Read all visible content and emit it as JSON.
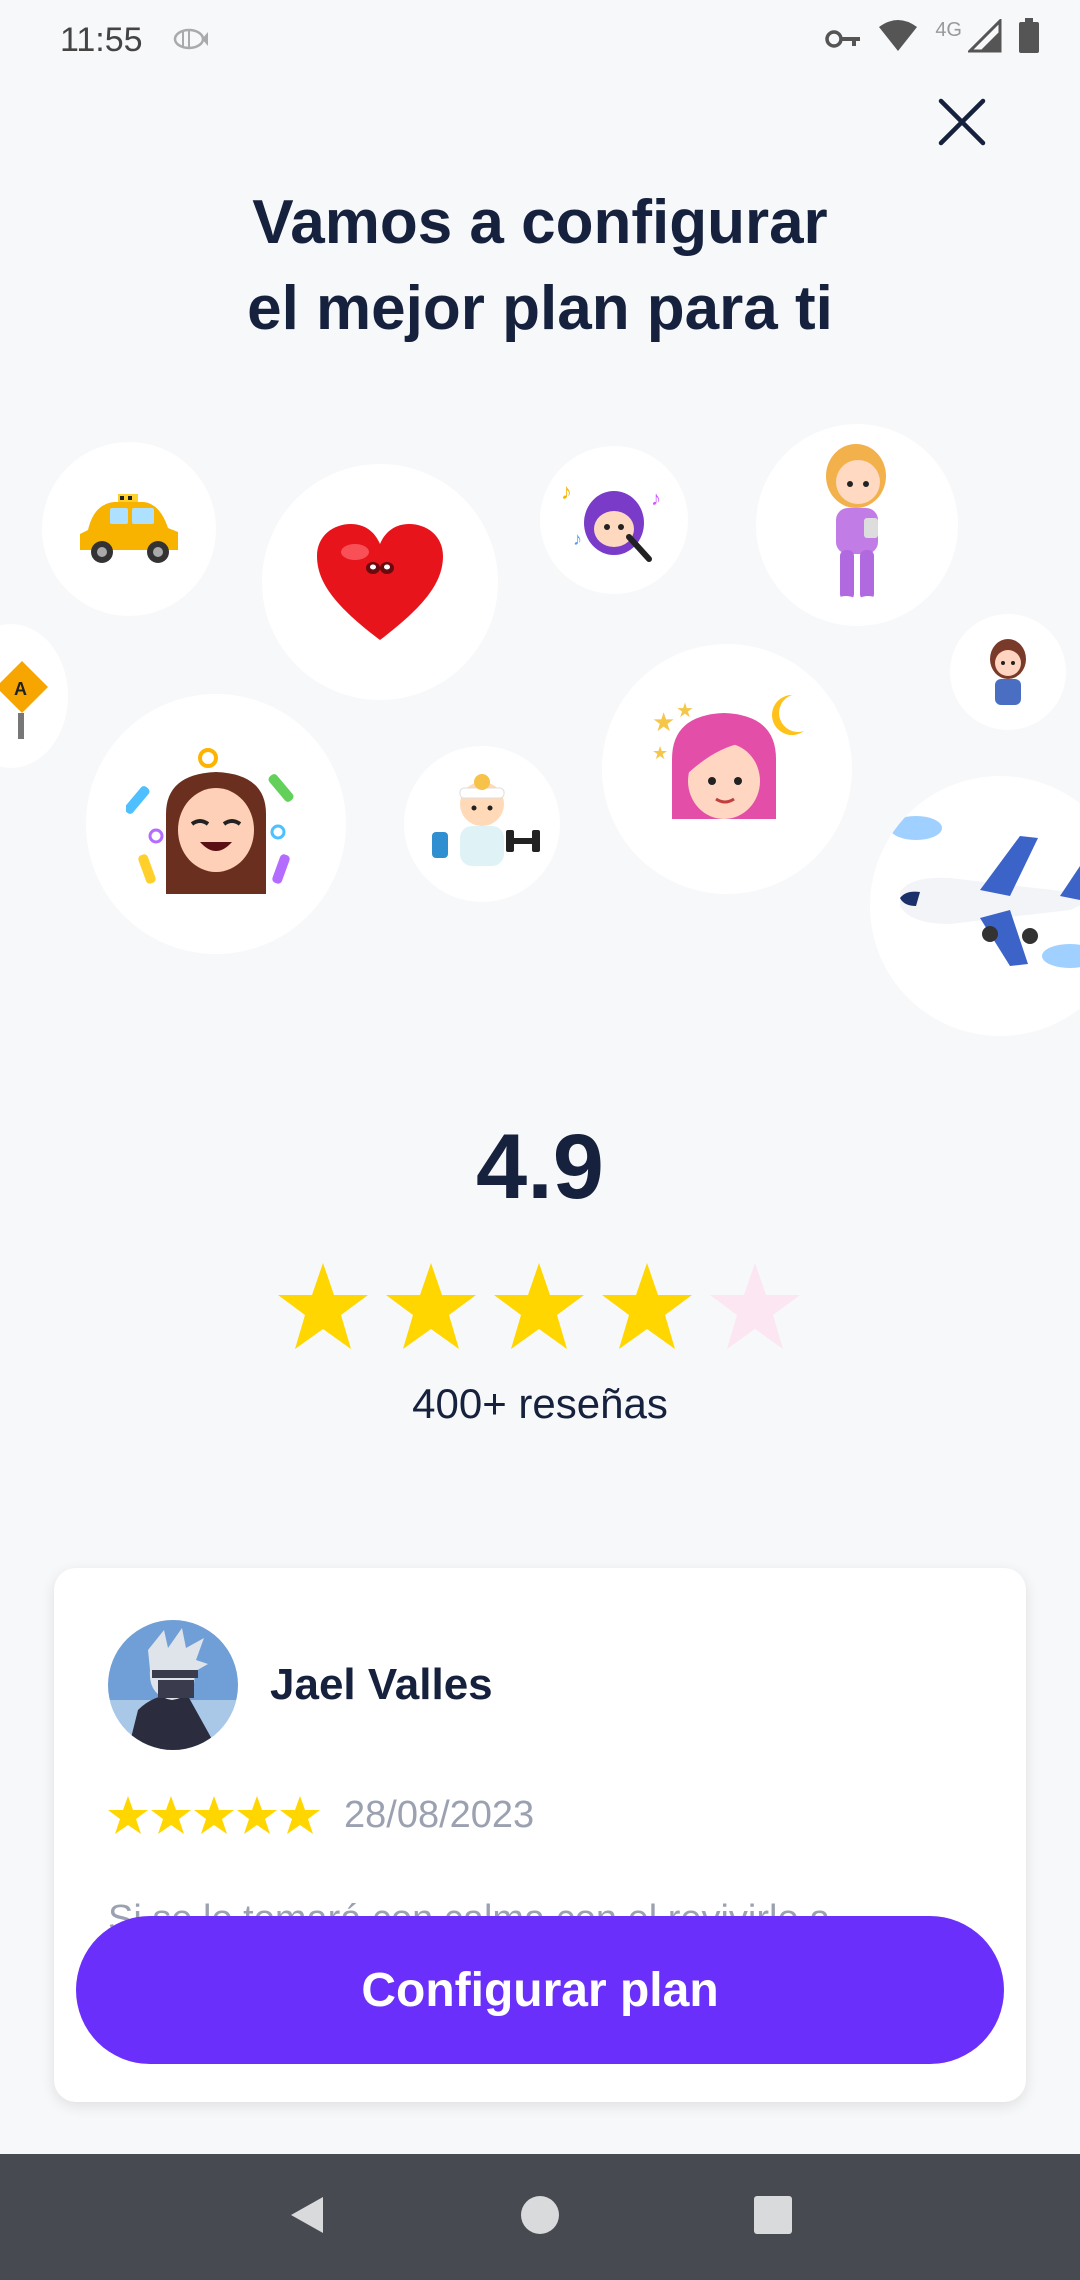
{
  "status": {
    "time": "11:55",
    "network": "4G",
    "icons": [
      "fish-icon",
      "key-icon",
      "wifi-icon",
      "signal-icon",
      "battery-icon"
    ]
  },
  "header": {
    "title_line1": "Vamos a configurar",
    "title_line2": "el mejor plan para ti"
  },
  "illustrations": [
    "taxi",
    "heart",
    "singer",
    "girl-standing",
    "road-sign",
    "small-girl",
    "laughing-girl",
    "athlete",
    "sleepy-girl",
    "airplane"
  ],
  "rating": {
    "value": "4.9",
    "stars": 4.9,
    "reviews_label": "400+ reseñas"
  },
  "review": {
    "name": "Jael Valles",
    "stars": 5,
    "date": "28/08/2023",
    "snippet": "Si se lo tomará con calma con el revivirlo a"
  },
  "cta": {
    "label": "Configurar plan"
  },
  "colors": {
    "accent": "#6a2ffa",
    "star": "#ffd600",
    "text": "#16213d",
    "muted": "#9ba1b0"
  }
}
